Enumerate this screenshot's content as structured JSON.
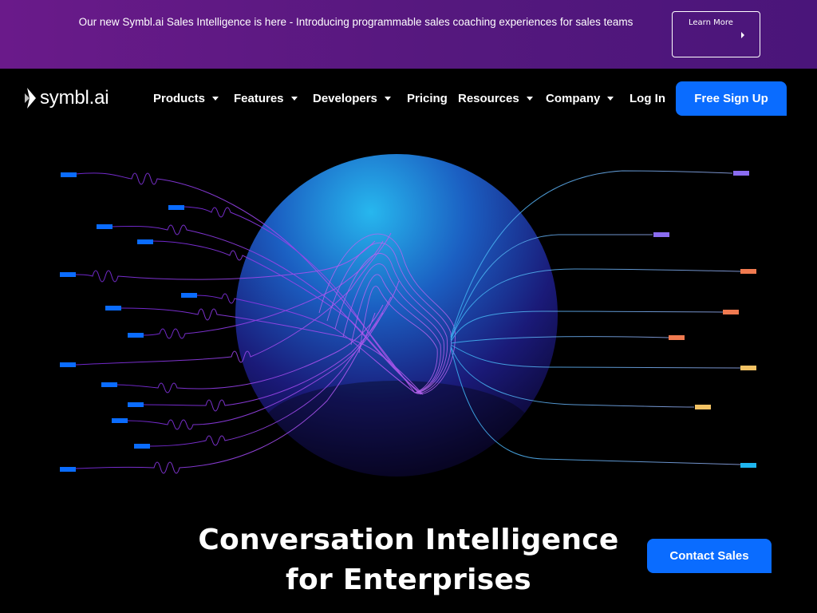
{
  "announcement": {
    "text": "Our new Symbl.ai Sales Intelligence is here - Introducing programmable sales coaching experiences for sales teams",
    "cta_label": "Learn More"
  },
  "brand": {
    "name": "symbl.ai"
  },
  "nav": {
    "items": [
      {
        "label": "Products",
        "has_dropdown": true
      },
      {
        "label": "Features",
        "has_dropdown": true
      },
      {
        "label": "Developers",
        "has_dropdown": true
      },
      {
        "label": "Pricing",
        "has_dropdown": false
      },
      {
        "label": "Resources",
        "has_dropdown": true
      },
      {
        "label": "Company",
        "has_dropdown": true
      },
      {
        "label": "Log In",
        "has_dropdown": false
      }
    ],
    "signup_label": "Free Sign Up"
  },
  "hero": {
    "headline_line1": "Conversation Intelligence",
    "headline_line2": "for Enterprises",
    "contact_label": "Contact Sales"
  },
  "colors": {
    "accent_blue": "#0a6cff",
    "banner_purple": "#5a1880",
    "tag_purple": "#8a6cf0",
    "tag_orange": "#f07a50",
    "tag_yellow": "#f2c264",
    "tag_cyan": "#1fb6f0"
  }
}
